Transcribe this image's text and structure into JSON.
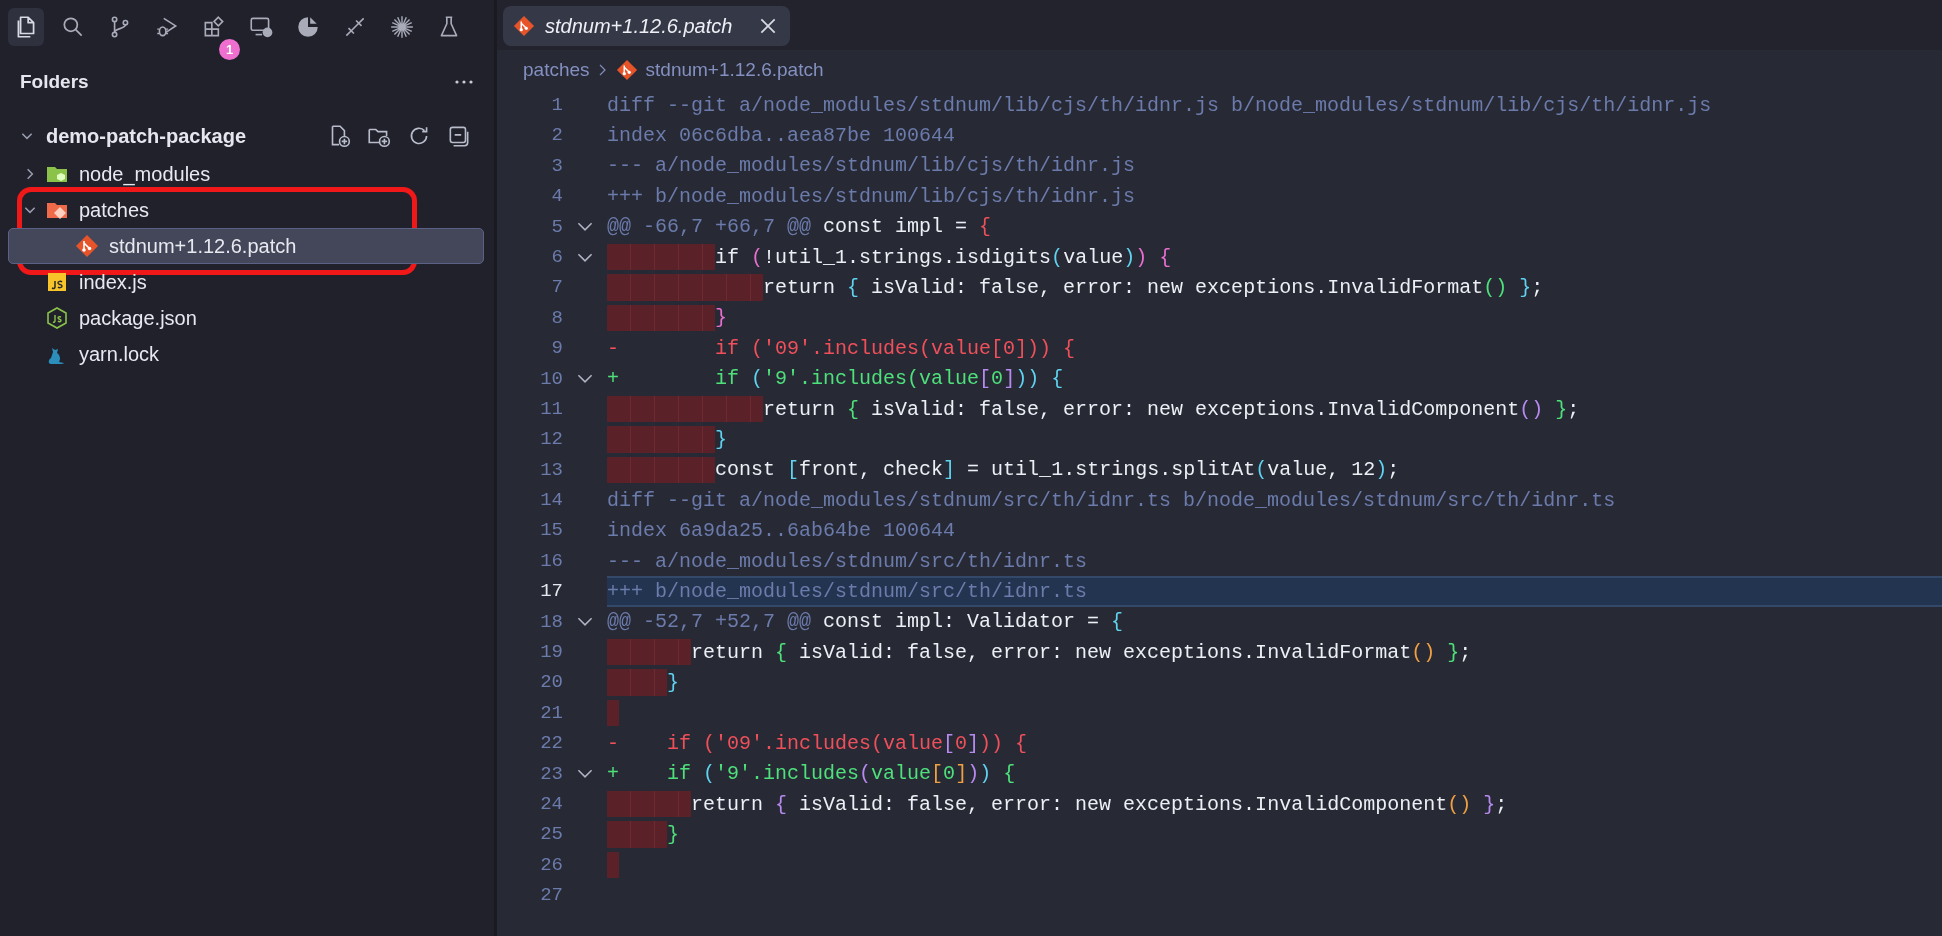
{
  "activity_bar": [
    {
      "selected": true
    },
    {
      "selected": false
    },
    {
      "selected": false
    },
    {
      "selected": false
    },
    {
      "selected": false,
      "badge": "1"
    },
    {
      "selected": false
    },
    {
      "selected": false
    },
    {
      "selected": false
    },
    {
      "selected": false
    },
    {
      "selected": false
    }
  ],
  "sidebar": {
    "title": "Folders",
    "root": {
      "name": "demo-patch-package",
      "expanded": true,
      "children": [
        {
          "name": "node_modules",
          "kind": "node-folder",
          "expanded": false,
          "selected": false,
          "circled": false
        },
        {
          "name": "patches",
          "kind": "patch-folder",
          "expanded": true,
          "selected": false,
          "circled": true,
          "children": [
            {
              "name": "stdnum+1.12.6.patch",
              "kind": "patch",
              "selected": true,
              "circled": false
            }
          ]
        },
        {
          "name": "index.js",
          "kind": "js",
          "selected": false,
          "circled": false
        },
        {
          "name": "package.json",
          "kind": "json",
          "selected": false,
          "circled": false
        },
        {
          "name": "yarn.lock",
          "kind": "yarn",
          "selected": false,
          "circled": false
        }
      ]
    }
  },
  "tabs": [
    {
      "label": "stdnum+1.12.6.patch",
      "selected": true,
      "italic": true
    }
  ],
  "breadcrumb": {
    "folder": "patches",
    "file": "stdnum+1.12.6.patch"
  },
  "lines": [
    {
      "number": "1",
      "selected": false,
      "fold": false,
      "indent_error": false,
      "tokens": [
        {
          "text": "diff --git a/node_modules/stdnum/lib/cjs/th/idnr.js b/node_modules/stdnum/lib/cjs/th/idnr.js",
          "color": "#6b7bab"
        }
      ]
    },
    {
      "number": "2",
      "selected": false,
      "fold": false,
      "indent_error": false,
      "tokens": [
        {
          "text": "index 06c6dba..aea87be 100644",
          "color": "#6b7bab"
        }
      ]
    },
    {
      "number": "3",
      "selected": false,
      "fold": false,
      "indent_error": false,
      "tokens": [
        {
          "text": "--- a/node_modules/stdnum/lib/cjs/th/idnr.js",
          "color": "#6b7bab"
        }
      ]
    },
    {
      "number": "4",
      "selected": false,
      "fold": false,
      "indent_error": false,
      "tokens": [
        {
          "text": "+++ b/node_modules/stdnum/lib/cjs/th/idnr.js",
          "color": "#6b7bab"
        }
      ]
    },
    {
      "number": "5",
      "selected": false,
      "fold": true,
      "indent_error": false,
      "tokens": [
        {
          "text": "@@ -66,7 +66,7 @@ ",
          "color": "#6b7bab"
        },
        {
          "text": "const impl = ",
          "color": "#eceff4"
        },
        {
          "text": "{",
          "color": "#f0505a"
        }
      ]
    },
    {
      "number": "6",
      "selected": false,
      "fold": true,
      "indent_error": true,
      "tokens": [
        {
          "text": "        if ",
          "color": "#eceff4"
        },
        {
          "text": "(",
          "color": "#e86fd0"
        },
        {
          "text": "!util_1.strings.isdigits",
          "color": "#eceff4"
        },
        {
          "text": "(",
          "color": "#5fd3f0"
        },
        {
          "text": "value",
          "color": "#eceff4"
        },
        {
          "text": ")",
          "color": "#5fd3f0"
        },
        {
          "text": ") {",
          "color": "#e86fd0"
        }
      ]
    },
    {
      "number": "7",
      "selected": false,
      "fold": false,
      "indent_error": true,
      "tokens": [
        {
          "text": "            return ",
          "color": "#eceff4"
        },
        {
          "text": "{",
          "color": "#5fd3f0"
        },
        {
          "text": " isValid: false, error: new exceptions.InvalidFormat",
          "color": "#eceff4"
        },
        {
          "text": "()",
          "color": "#4ee07a"
        },
        {
          "text": " }",
          "color": "#5fd3f0"
        },
        {
          "text": ";",
          "color": "#eceff4"
        }
      ]
    },
    {
      "number": "8",
      "selected": false,
      "fold": false,
      "indent_error": true,
      "tokens": [
        {
          "text": "        }",
          "color": "#e86fd0"
        }
      ]
    },
    {
      "number": "9",
      "selected": false,
      "fold": false,
      "indent_error": false,
      "tokens": [
        {
          "text": "-        if ('09'.includes(value[0])) {",
          "color": "#f0505a"
        }
      ]
    },
    {
      "number": "10",
      "selected": false,
      "fold": true,
      "indent_error": false,
      "tokens": [
        {
          "text": "+        if ",
          "color": "#4ee07a"
        },
        {
          "text": "(",
          "color": "#5fd3f0"
        },
        {
          "text": "'9'.includes(value",
          "color": "#4ee07a"
        },
        {
          "text": "[",
          "color": "#b78af0"
        },
        {
          "text": "0",
          "color": "#4ee07a"
        },
        {
          "text": "]",
          "color": "#b78af0"
        },
        {
          "text": ")) {",
          "color": "#5fd3f0"
        }
      ]
    },
    {
      "number": "11",
      "selected": false,
      "fold": false,
      "indent_error": true,
      "tokens": [
        {
          "text": "            return ",
          "color": "#eceff4"
        },
        {
          "text": "{",
          "color": "#4ee07a"
        },
        {
          "text": " isValid: false, error: new exceptions.InvalidComponent",
          "color": "#eceff4"
        },
        {
          "text": "()",
          "color": "#b78af0"
        },
        {
          "text": " }",
          "color": "#4ee07a"
        },
        {
          "text": ";",
          "color": "#eceff4"
        }
      ]
    },
    {
      "number": "12",
      "selected": false,
      "fold": false,
      "indent_error": true,
      "tokens": [
        {
          "text": "        }",
          "color": "#5fd3f0"
        }
      ]
    },
    {
      "number": "13",
      "selected": false,
      "fold": false,
      "indent_error": true,
      "tokens": [
        {
          "text": "        const ",
          "color": "#eceff4"
        },
        {
          "text": "[",
          "color": "#5fd3f0"
        },
        {
          "text": "front, check",
          "color": "#eceff4"
        },
        {
          "text": "]",
          "color": "#5fd3f0"
        },
        {
          "text": " = util_1.strings.splitAt",
          "color": "#eceff4"
        },
        {
          "text": "(",
          "color": "#5fd3f0"
        },
        {
          "text": "value, 12",
          "color": "#eceff4"
        },
        {
          "text": ")",
          "color": "#5fd3f0"
        },
        {
          "text": ";",
          "color": "#eceff4"
        }
      ]
    },
    {
      "number": "14",
      "selected": false,
      "fold": false,
      "indent_error": false,
      "tokens": [
        {
          "text": "diff --git a/node_modules/stdnum/src/th/idnr.ts b/node_modules/stdnum/src/th/idnr.ts",
          "color": "#6b7bab"
        }
      ]
    },
    {
      "number": "15",
      "selected": false,
      "fold": false,
      "indent_error": false,
      "tokens": [
        {
          "text": "index 6a9da25..6ab64be 100644",
          "color": "#6b7bab"
        }
      ]
    },
    {
      "number": "16",
      "selected": false,
      "fold": false,
      "indent_error": false,
      "tokens": [
        {
          "text": "--- a/node_modules/stdnum/src/th/idnr.ts",
          "color": "#6b7bab"
        }
      ]
    },
    {
      "number": "17",
      "selected": true,
      "fold": false,
      "indent_error": false,
      "tokens": [
        {
          "text": "+++ b/node_modules/stdnum/src/th/idnr.ts",
          "color": "#6b7bab"
        }
      ]
    },
    {
      "number": "18",
      "selected": false,
      "fold": true,
      "indent_error": false,
      "tokens": [
        {
          "text": "@@ -52,7 +52,7 @@ ",
          "color": "#6b7bab"
        },
        {
          "text": "const impl: Validator = ",
          "color": "#eceff4"
        },
        {
          "text": "{",
          "color": "#5fd3f0"
        }
      ]
    },
    {
      "number": "19",
      "selected": false,
      "fold": false,
      "indent_error": true,
      "tokens": [
        {
          "text": "      return ",
          "color": "#eceff4"
        },
        {
          "text": "{",
          "color": "#4ee07a"
        },
        {
          "text": " isValid: false, error: new exceptions.InvalidFormat",
          "color": "#eceff4"
        },
        {
          "text": "()",
          "color": "#f0a040"
        },
        {
          "text": " }",
          "color": "#4ee07a"
        },
        {
          "text": ";",
          "color": "#eceff4"
        }
      ]
    },
    {
      "number": "20",
      "selected": false,
      "fold": false,
      "indent_error": true,
      "tokens": [
        {
          "text": "    }",
          "color": "#5fd3f0"
        }
      ]
    },
    {
      "number": "21",
      "selected": false,
      "fold": false,
      "indent_error": true
    },
    {
      "number": "22",
      "selected": false,
      "fold": false,
      "indent_error": false,
      "tokens": [
        {
          "text": "-    if ('09'.includes(value",
          "color": "#f0505a"
        },
        {
          "text": "[",
          "color": "#b78af0"
        },
        {
          "text": "0",
          "color": "#f0505a"
        },
        {
          "text": "]",
          "color": "#b78af0"
        },
        {
          "text": ")) {",
          "color": "#f0505a"
        }
      ]
    },
    {
      "number": "23",
      "selected": false,
      "fold": true,
      "indent_error": false,
      "tokens": [
        {
          "text": "+    if ",
          "color": "#4ee07a"
        },
        {
          "text": "(",
          "color": "#5fd3f0"
        },
        {
          "text": "'9'.includes",
          "color": "#4ee07a"
        },
        {
          "text": "(",
          "color": "#b78af0"
        },
        {
          "text": "value",
          "color": "#4ee07a"
        },
        {
          "text": "[",
          "color": "#f0a040"
        },
        {
          "text": "0",
          "color": "#4ee07a"
        },
        {
          "text": "]",
          "color": "#f0a040"
        },
        {
          "text": ")",
          "color": "#b78af0"
        },
        {
          "text": ")",
          "color": "#5fd3f0"
        },
        {
          "text": " {",
          "color": "#4ee07a"
        }
      ]
    },
    {
      "number": "24",
      "selected": false,
      "fold": false,
      "indent_error": true,
      "tokens": [
        {
          "text": "      return ",
          "color": "#eceff4"
        },
        {
          "text": "{",
          "color": "#b78af0"
        },
        {
          "text": " isValid: false, error: new exceptions.InvalidComponent",
          "color": "#eceff4"
        },
        {
          "text": "()",
          "color": "#f0a040"
        },
        {
          "text": " }",
          "color": "#b78af0"
        },
        {
          "text": ";",
          "color": "#eceff4"
        }
      ]
    },
    {
      "number": "25",
      "selected": false,
      "fold": false,
      "indent_error": true,
      "tokens": [
        {
          "text": "    }",
          "color": "#4ee07a"
        }
      ]
    },
    {
      "number": "26",
      "selected": false,
      "fold": false,
      "indent_error": true
    },
    {
      "number": "27",
      "selected": false,
      "fold": false,
      "indent_error": false
    }
  ]
}
